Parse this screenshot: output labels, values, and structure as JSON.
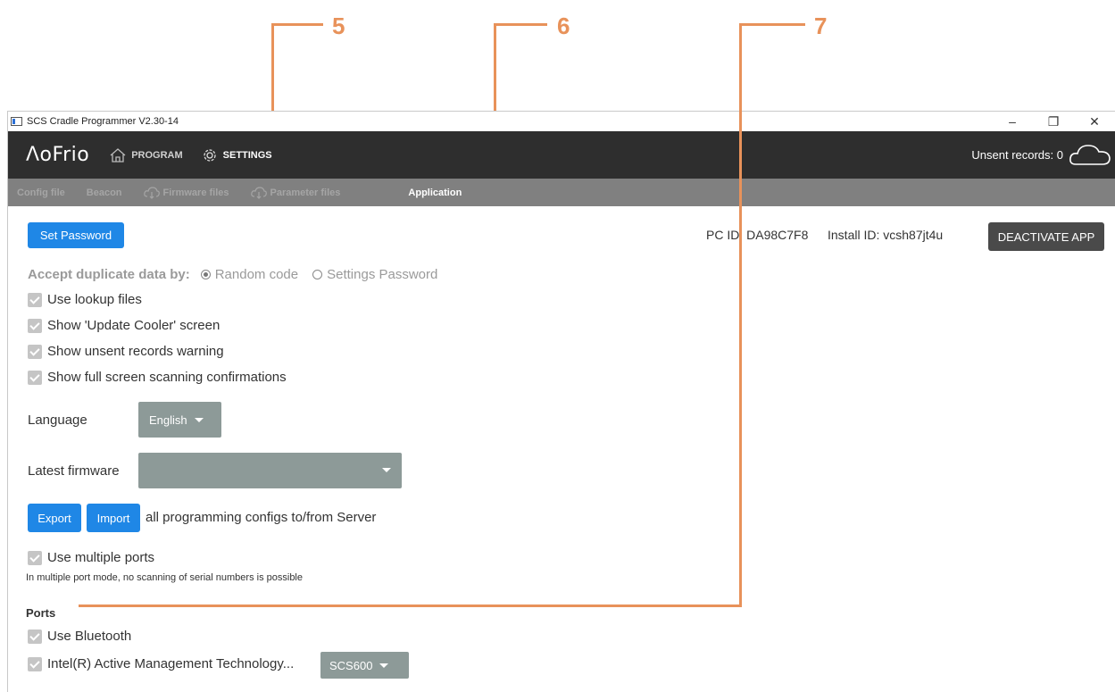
{
  "callouts": [
    "5",
    "6",
    "7"
  ],
  "window": {
    "title": "SCS Cradle Programmer V2.30-14",
    "controls": {
      "minimize": "–",
      "maximize": "❐",
      "close": "✕"
    }
  },
  "topnav": {
    "logo": "ΛoFrio",
    "items": [
      {
        "label": "PROGRAM",
        "icon": "home-icon"
      },
      {
        "label": "SETTINGS",
        "icon": "gear-icon"
      }
    ],
    "unsent": "Unsent records: 0"
  },
  "subnav": {
    "items": [
      {
        "label": "Config file"
      },
      {
        "label": "Beacon"
      },
      {
        "label": "Firmware files",
        "icon": "cloud-download-icon"
      },
      {
        "label": "Parameter files",
        "icon": "cloud-download-icon"
      },
      {
        "label": "Application"
      }
    ]
  },
  "content": {
    "set_password": "Set Password",
    "pc_id": "PC ID: DA98C7F8",
    "install_id": "Install ID: vcsh87jt4u",
    "deactivate": "DEACTIVATE APP",
    "accept_label": "Accept duplicate data by:",
    "radio_options": [
      "Random code",
      "Settings Password"
    ],
    "checks": [
      "Use lookup files",
      "Show 'Update Cooler' screen",
      "Show unsent records warning",
      "Show full screen scanning confirmations"
    ],
    "language_label": "Language",
    "language_value": "English",
    "firmware_label": "Latest firmware",
    "firmware_value": "",
    "export": "Export",
    "import": "Import",
    "configs_text": "all programming configs to/from Server",
    "use_multiple_ports": "Use multiple ports",
    "multi_port_note": "In multiple port mode, no scanning of serial numbers is possible",
    "ports_heading": "Ports",
    "use_bluetooth": "Use Bluetooth",
    "intel_port": "Intel(R) Active Management Technology...",
    "intel_port_select": "SCS600"
  }
}
